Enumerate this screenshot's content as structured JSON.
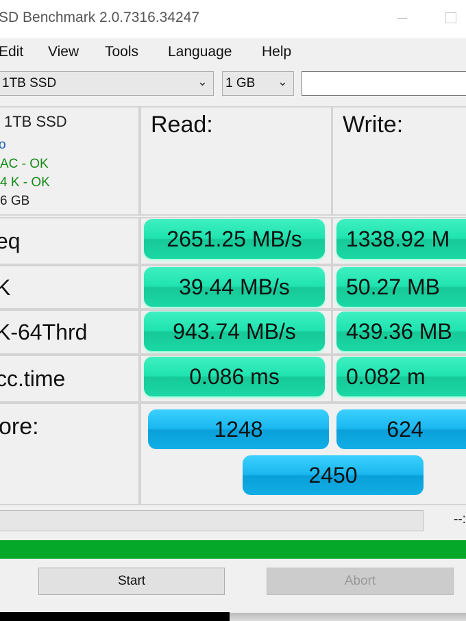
{
  "window": {
    "title": "SD Benchmark 2.0.7316.34247"
  },
  "menu": [
    "Edit",
    "View",
    "Tools",
    "Language",
    "Help"
  ],
  "toolbar": {
    "drive": "1TB SSD",
    "size": "1 GB",
    "extra": ""
  },
  "info": {
    "name": "1TB SSD",
    "line2": "o",
    "line3": "AC - OK",
    "line4": "4 K - OK",
    "line5": "6 GB"
  },
  "headers": {
    "read": "Read:",
    "write": "Write:"
  },
  "rows": [
    {
      "label": "eq",
      "read": "2651.25 MB/s",
      "write": "1338.92 M"
    },
    {
      "label": "K",
      "read": "39.44 MB/s",
      "write": "50.27 MB"
    },
    {
      "label": "K-64Thrd",
      "read": "943.74 MB/s",
      "write": "439.36 MB"
    },
    {
      "label": "cc.time",
      "read": "0.086 ms",
      "write": "0.082 m"
    }
  ],
  "score": {
    "label": "ore:",
    "read": "1248",
    "write": "624",
    "total": "2450"
  },
  "progress": {
    "time": "--:",
    "percent": 0
  },
  "status_bar": {
    "color": "#06a82a",
    "percent": 100
  },
  "buttons": {
    "start": "Start",
    "abort": "Abort"
  },
  "colors": {
    "result": "#1fe3b0",
    "score": "#1ab7ef"
  }
}
